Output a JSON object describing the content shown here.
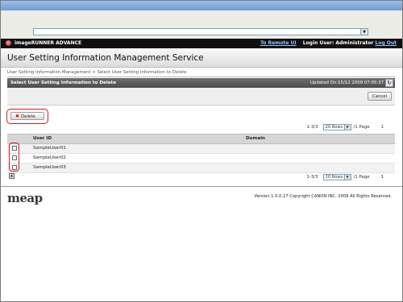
{
  "header": {
    "brand": "imageRUNNER ADVANCE",
    "to_remote_ui": "To Remote UI",
    "login_user_label": "Login User: Administrator",
    "log_out": "Log Out"
  },
  "service_title": "User Setting Information Management Service",
  "breadcrumb": "User Setting Information Management > Select User Setting Information to Delete",
  "panel": {
    "title": "Select User Setting Information to Delete",
    "updated": "Updated On:15/12 2009 07:05:37",
    "cancel_label": "Cancel"
  },
  "delete_label": "Delete",
  "pagination": {
    "range": "1-3/3",
    "rows_option": "20 Rows",
    "page_label": "/1 Page",
    "page_number": "1"
  },
  "table": {
    "columns": [
      "User ID",
      "Domain"
    ],
    "rows": [
      {
        "user_id": "SampleUser01",
        "domain": ""
      },
      {
        "user_id": "SampleUser02",
        "domain": ""
      },
      {
        "user_id": "SampleUser03",
        "domain": ""
      }
    ]
  },
  "footer": {
    "logo": "meap",
    "copyright": "Version 1.0.0.27 Copyright CANON INC. 2009 All Rights Reserved."
  }
}
